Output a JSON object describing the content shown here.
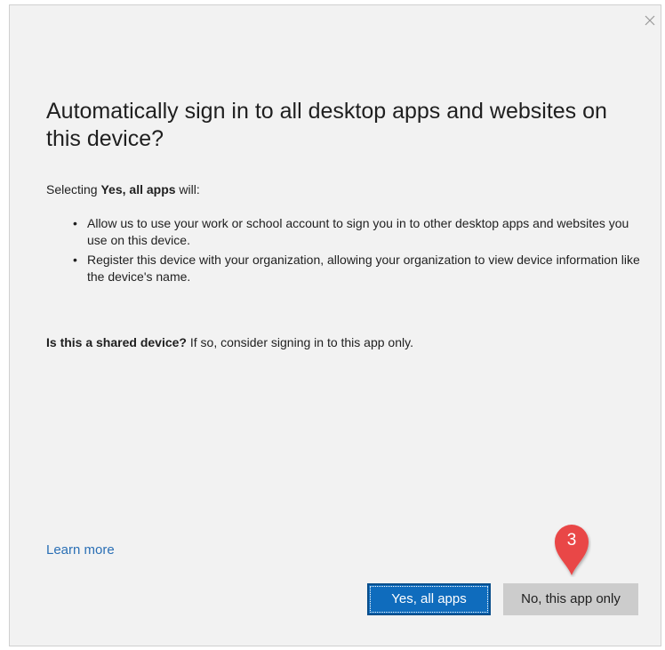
{
  "dialog": {
    "close_icon": "close-icon",
    "title": "Automatically sign in to all desktop apps and websites on this device?",
    "intro": {
      "prefix": "Selecting ",
      "bold": "Yes, all apps",
      "suffix": " will:"
    },
    "bullets": [
      "Allow us to use your work or school account to sign you in to other desktop apps and websites you use on this device.",
      "Register this device with your organization, allowing your organization to view device information like the device's name."
    ],
    "shared": {
      "bold": "Is this a shared device?",
      "rest": " If so, consider signing in to this app only."
    },
    "learn_more": "Learn more",
    "buttons": {
      "yes": "Yes, all apps",
      "no": "No, this app only"
    }
  },
  "annotation": {
    "label": "3",
    "color": "#e94747"
  },
  "colors": {
    "background": "#f2f2f2",
    "link": "#2a6fb5",
    "primary_button": "#0f6cbd",
    "secondary_button": "#cccccc"
  }
}
